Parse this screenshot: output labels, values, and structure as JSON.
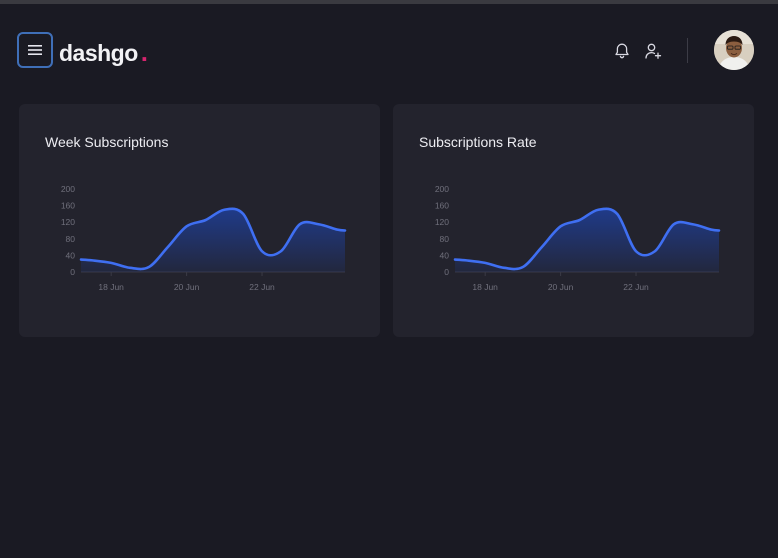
{
  "header": {
    "menu_icon": "hamburger-icon",
    "logo_text": "dashgo",
    "logo_dot": ".",
    "logo_dot_color": "#d6246e",
    "notification_icon": "bell-icon",
    "add_user_icon": "user-plus-icon",
    "avatar_icon": "user-avatar"
  },
  "cards": [
    {
      "title": "Week Subscriptions",
      "chart_data": {
        "type": "area",
        "x": [
          "17.2",
          "17.5",
          "18.0",
          "18.5",
          "19.0",
          "19.5",
          "20.0",
          "20.5",
          "21.0",
          "21.5",
          "22.0",
          "22.5",
          "23.0",
          "23.5",
          "24.0",
          "24.2"
        ],
        "x_ticks": [
          "18 Jun",
          "20 Jun",
          "22 Jun"
        ],
        "y_ticks": [
          "0",
          "40",
          "80",
          "120",
          "160",
          "200"
        ],
        "ylim": [
          0,
          200
        ],
        "values": [
          30,
          28,
          22,
          10,
          12,
          60,
          110,
          125,
          150,
          140,
          50,
          50,
          115,
          115,
          102,
          100
        ],
        "line_color": "#3f6ff2",
        "fill_color": "#1f3f9a"
      }
    },
    {
      "title": "Subscriptions Rate",
      "chart_data": {
        "type": "area",
        "x": [
          "17.2",
          "17.5",
          "18.0",
          "18.5",
          "19.0",
          "19.5",
          "20.0",
          "20.5",
          "21.0",
          "21.5",
          "22.0",
          "22.5",
          "23.0",
          "23.5",
          "24.0",
          "24.2"
        ],
        "x_ticks": [
          "18 Jun",
          "20 Jun",
          "22 Jun"
        ],
        "y_ticks": [
          "0",
          "40",
          "80",
          "120",
          "160",
          "200"
        ],
        "ylim": [
          0,
          200
        ],
        "values": [
          30,
          28,
          22,
          10,
          12,
          60,
          110,
          125,
          150,
          140,
          50,
          50,
          115,
          115,
          102,
          100
        ],
        "line_color": "#3f6ff2",
        "fill_color": "#1f3f9a"
      }
    }
  ]
}
